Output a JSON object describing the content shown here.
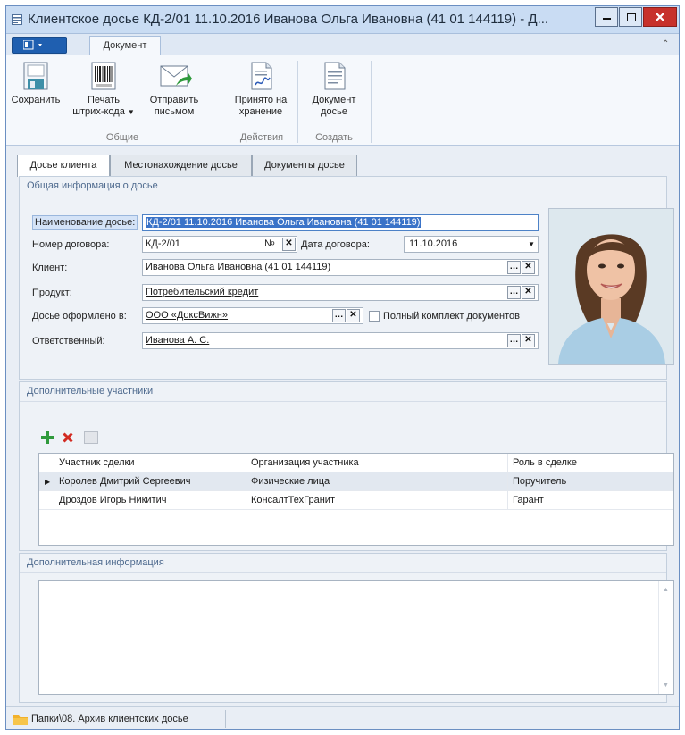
{
  "window": {
    "title": "Клиентское досье КД-2/01 11.10.2016 Иванова Ольга Ивановна (41 01 144119) - Д..."
  },
  "ribbon": {
    "tab": "Документ",
    "buttons": {
      "save": "Сохранить",
      "print_barcode_line1": "Печать",
      "print_barcode_line2": "штрих-кода",
      "send_mail_line1": "Отправить",
      "send_mail_line2": "письмом",
      "accept_line1": "Принято на",
      "accept_line2": "хранение",
      "dossier_doc_line1": "Документ",
      "dossier_doc_line2": "досье"
    },
    "groups": {
      "general": "Общие",
      "actions": "Действия",
      "create": "Создать"
    }
  },
  "tabs": [
    "Досье клиента",
    "Местонахождение досье",
    "Документы досье"
  ],
  "general": {
    "section_title": "Общая информация о досье",
    "name_label": "Наименование досье:",
    "name_value": "КД-2/01 11.10.2016 Иванова Ольга Ивановна (41 01 144119)",
    "contract_no_label": "Номер договора:",
    "contract_no_value": "КД-2/01",
    "no_sign": "№",
    "contract_date_label": "Дата договора:",
    "contract_date_value": "11.10.2016",
    "client_label": "Клиент:",
    "client_value": "Иванова Ольга Ивановна (41 01 144119)",
    "product_label": "Продукт:",
    "product_value": "Потребительский кредит",
    "issued_label": "Досье оформлено в:",
    "issued_value": "ООО «ДоксВижн»",
    "full_set_label": "Полный комплект документов",
    "responsible_label": "Ответственный:",
    "responsible_value": "Иванова А. С."
  },
  "participants": {
    "section_title": "Дополнительные участники",
    "columns": [
      "Участник сделки",
      "Организация участника",
      "Роль в сделке"
    ],
    "rows": [
      [
        "Королев Дмитрий Сергеевич",
        "Физические лица",
        "Поручитель"
      ],
      [
        "Дроздов Игорь Никитич",
        "КонсалтТехГранит",
        "Гарант"
      ]
    ]
  },
  "additional": {
    "section_title": "Дополнительная информация"
  },
  "status": {
    "path": "Папки\\08. Архив клиентских досье"
  },
  "colors": {
    "accent": "#1f5fb0",
    "selection": "#3a73c8",
    "section_title": "#4e6a8e",
    "close_button": "#c7312b"
  }
}
